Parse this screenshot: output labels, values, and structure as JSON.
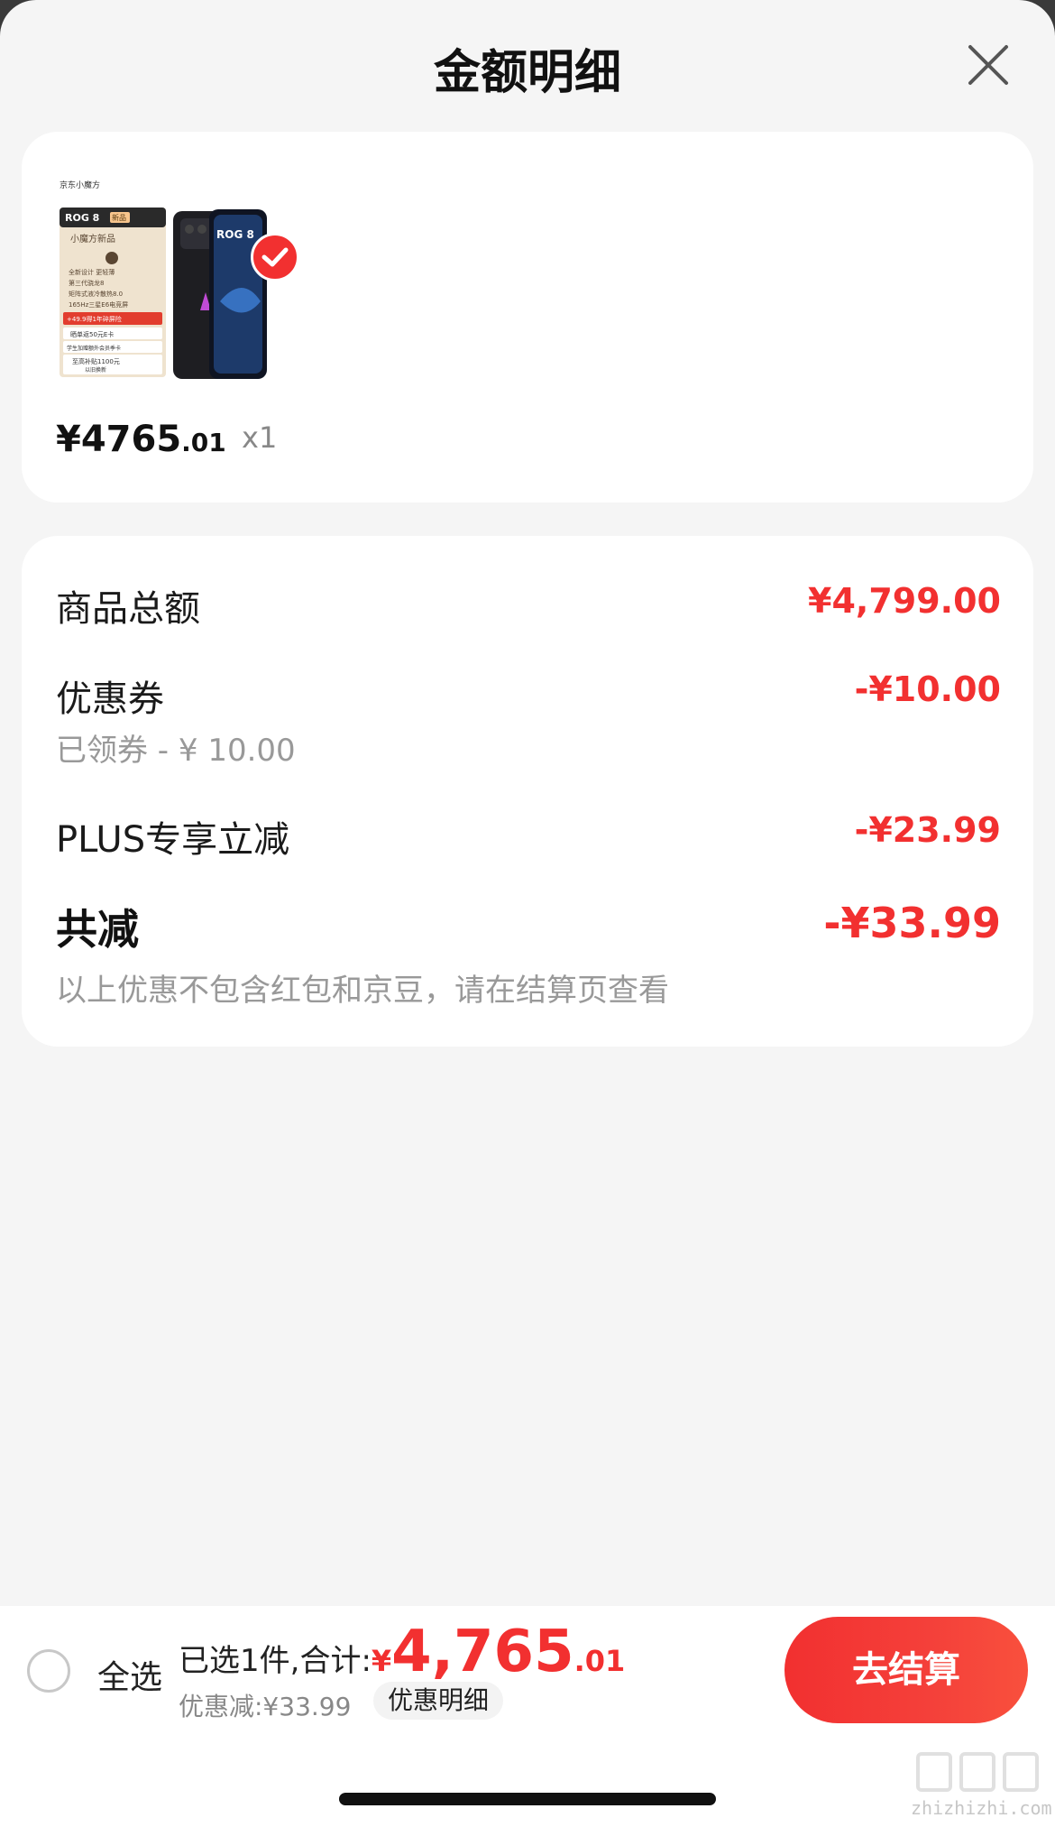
{
  "header": {
    "title": "金额明细"
  },
  "product": {
    "price_main": "¥4765",
    "price_sub": ".01",
    "qty": "x1",
    "thumb": {
      "brand_text": "京东小魔方",
      "model": "ROG 8",
      "model_badge": "新品",
      "tagline": "小魔方新品",
      "features": [
        "全新设计 更轻薄",
        "第三代骁龙8",
        "矩阵式液冷散热8.0",
        "165Hz三星E6电竞屏"
      ],
      "promo_red": "+49.9得1年碎屏险",
      "promo_1": "晒单返50元E卡",
      "promo_2": "学生加赠额外会员季卡",
      "promo_3": "至高补贴1100元",
      "promo_4": "以旧换新",
      "phone_text": "ROG 8"
    }
  },
  "breakdown": {
    "goods_total_label": "商品总额",
    "goods_total_value": "¥4,799.00",
    "coupon_label": "优惠券",
    "coupon_sub": "已领券 - ¥ 10.00",
    "coupon_value": "-¥10.00",
    "plus_label": "PLUS专享立减",
    "plus_value": "-¥23.99",
    "total_label": "共减",
    "total_value": "-¥33.99",
    "note": "以上优惠不包含红包和京豆，请在结算页查看"
  },
  "bottom_bar": {
    "select_all": "全选",
    "summary_prefix": "已选1件,合计:",
    "total_yen": "¥",
    "total_main": "4,765",
    "total_sub": ".01",
    "discount": "优惠减:¥33.99",
    "detail_link": "优惠明细",
    "checkout": "去结算"
  },
  "watermark": {
    "text": "zhizhizhi.com"
  },
  "colors": {
    "accent": "#f23030",
    "background": "#f5f5f5",
    "card": "#ffffff"
  }
}
